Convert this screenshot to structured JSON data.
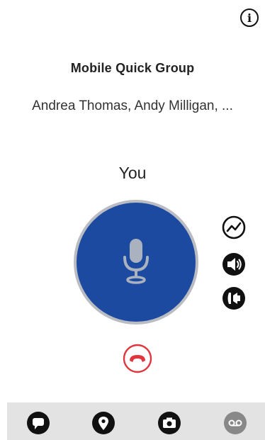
{
  "header": {
    "info_icon": "info-icon",
    "info_glyph": "i"
  },
  "group": {
    "name": "Mobile Quick Group",
    "members": "Andrea Thomas, Andy Milligan, ..."
  },
  "talk": {
    "speaker": "You",
    "ptt_icon": "microphone-icon",
    "ptt_color": "#1c4aa0",
    "hangup_color": "#e0353f"
  },
  "side_actions": [
    {
      "name": "activity-icon"
    },
    {
      "name": "speaker-icon"
    },
    {
      "name": "earpiece-icon"
    }
  ],
  "bottom_bar": {
    "items": [
      {
        "name": "message-icon"
      },
      {
        "name": "location-icon"
      },
      {
        "name": "camera-icon"
      },
      {
        "name": "voicemail-icon",
        "color": "#888888"
      }
    ]
  }
}
